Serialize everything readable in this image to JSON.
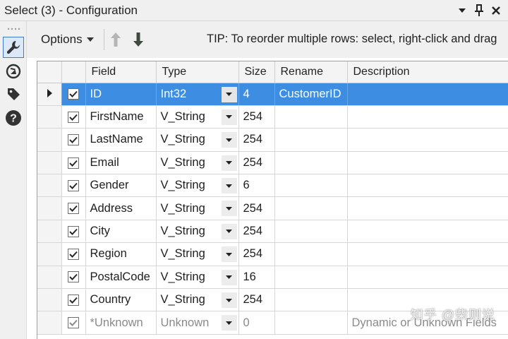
{
  "window": {
    "title": "Select (3) - Configuration",
    "controls": [
      "dropdown-icon",
      "pin-icon",
      "close-icon"
    ]
  },
  "left_toolbar": {
    "buttons": [
      {
        "icon": "wrench-icon",
        "active": true
      },
      {
        "icon": "navigate-icon",
        "active": false
      },
      {
        "icon": "tag-icon",
        "active": false
      },
      {
        "icon": "help-icon",
        "active": false
      }
    ]
  },
  "toolbar": {
    "options_label": "Options",
    "move_up_icon": "arrow-up-icon",
    "move_down_icon": "arrow-down-icon",
    "tip": "TIP: To reorder multiple rows: select, right-click and drag"
  },
  "grid": {
    "columns": [
      "Field",
      "Type",
      "Size",
      "Rename",
      "Description"
    ],
    "rows": [
      {
        "checked": true,
        "field": "ID",
        "type": "Int32",
        "size": "4",
        "rename": "CustomerID",
        "description": "",
        "selected": true
      },
      {
        "checked": true,
        "field": "FirstName",
        "type": "V_String",
        "size": "254",
        "rename": "",
        "description": ""
      },
      {
        "checked": true,
        "field": "LastName",
        "type": "V_String",
        "size": "254",
        "rename": "",
        "description": ""
      },
      {
        "checked": true,
        "field": "Email",
        "type": "V_String",
        "size": "254",
        "rename": "",
        "description": ""
      },
      {
        "checked": true,
        "field": "Gender",
        "type": "V_String",
        "size": "6",
        "rename": "",
        "description": ""
      },
      {
        "checked": true,
        "field": "Address",
        "type": "V_String",
        "size": "254",
        "rename": "",
        "description": ""
      },
      {
        "checked": true,
        "field": "City",
        "type": "V_String",
        "size": "254",
        "rename": "",
        "description": ""
      },
      {
        "checked": true,
        "field": "Region",
        "type": "V_String",
        "size": "254",
        "rename": "",
        "description": ""
      },
      {
        "checked": true,
        "field": "PostalCode",
        "type": "V_String",
        "size": "16",
        "rename": "",
        "description": ""
      },
      {
        "checked": true,
        "field": "Country",
        "type": "V_String",
        "size": "254",
        "rename": "",
        "description": ""
      },
      {
        "checked": true,
        "field": "*Unknown",
        "type": "Unknown",
        "size": "0",
        "rename": "",
        "description": "Dynamic or Unknown Fields",
        "dim": true
      }
    ]
  },
  "watermark": "知乎 @柴则说",
  "colors": {
    "selection": "#3d8ee3",
    "chrome": "#f0f0f0",
    "active_tool_border": "#3f7cc5"
  }
}
